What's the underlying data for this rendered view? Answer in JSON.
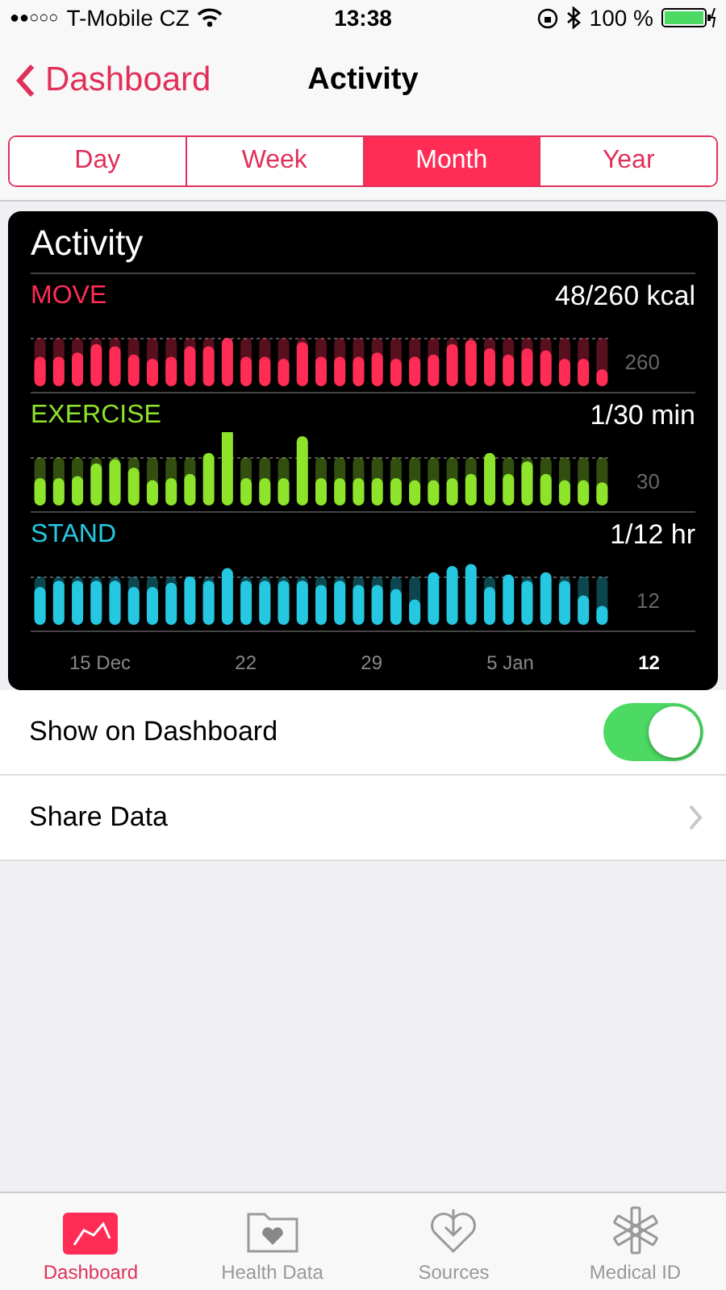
{
  "status_bar": {
    "carrier": "T-Mobile CZ",
    "signal_dots": "●●○○○",
    "time": "13:38",
    "battery": "100 %"
  },
  "nav": {
    "back": "Dashboard",
    "title": "Activity"
  },
  "segments": [
    {
      "label": "Day",
      "selected": false
    },
    {
      "label": "Week",
      "selected": false
    },
    {
      "label": "Month",
      "selected": true
    },
    {
      "label": "Year",
      "selected": false
    }
  ],
  "card": {
    "title": "Activity",
    "rings": [
      {
        "kind": "move",
        "name": "MOVE",
        "reading": "48/260 kcal",
        "goal_label": "260",
        "color": "#ff2d55"
      },
      {
        "kind": "exercise",
        "name": "EXERCISE",
        "reading": "1/30 min",
        "goal_label": "30",
        "color": "#8ee32b"
      },
      {
        "kind": "stand",
        "name": "STAND",
        "reading": "1/12 hr",
        "goal_label": "12",
        "color": "#25c8e0"
      }
    ],
    "dates": [
      {
        "label": "15 Dec",
        "current": false
      },
      {
        "label": "22",
        "current": false
      },
      {
        "label": "29",
        "current": false
      },
      {
        "label": "5 Jan",
        "current": false
      },
      {
        "label": "12",
        "current": true
      }
    ]
  },
  "settings": [
    {
      "kind": "toggle",
      "label": "Show on Dashboard",
      "on": true
    },
    {
      "kind": "link",
      "label": "Share Data"
    }
  ],
  "tab_bar": [
    {
      "label": "Dashboard",
      "selected": true
    },
    {
      "label": "Health Data",
      "selected": false
    },
    {
      "label": "Sources",
      "selected": false
    },
    {
      "label": "Medical ID",
      "selected": false
    }
  ]
}
